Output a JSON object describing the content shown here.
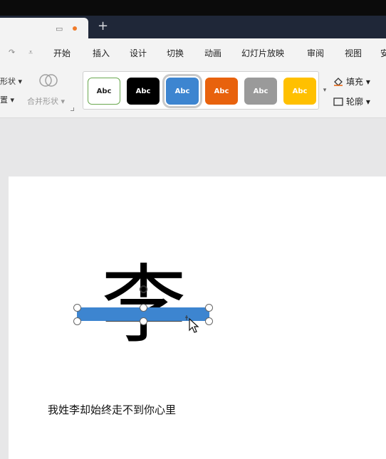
{
  "tabs": {
    "new_tab_label": "+"
  },
  "menu": {
    "items": [
      "开始",
      "插入",
      "设计",
      "切换",
      "动画",
      "幻灯片放映",
      "审阅",
      "视图",
      "安"
    ]
  },
  "ribbon": {
    "shape_label": "形状",
    "arrange_label": "置",
    "merge_shapes_label": "合并形状",
    "styles": [
      {
        "label": "Abc",
        "bg": "#ffffff",
        "fg": "#222222",
        "border": "#6aa84f"
      },
      {
        "label": "Abc",
        "bg": "#000000",
        "fg": "#ffffff",
        "border": "#000000"
      },
      {
        "label": "Abc",
        "bg": "#3d85d0",
        "fg": "#ffffff",
        "border": "#3d85d0"
      },
      {
        "label": "Abc",
        "bg": "#e8620d",
        "fg": "#ffffff",
        "border": "#e8620d"
      },
      {
        "label": "Abc",
        "bg": "#9a9a9a",
        "fg": "#ffffff",
        "border": "#9a9a9a"
      },
      {
        "label": "Abc",
        "bg": "#ffc000",
        "fg": "#ffffff",
        "border": "#ffc000"
      }
    ],
    "fill_label": "填充",
    "outline_label": "轮廓"
  },
  "slide": {
    "big_char": "李",
    "caption": "我姓李却始终走不到你心里"
  },
  "colors": {
    "accent": "#3d85d0",
    "tab_dot": "#f07b2a"
  }
}
